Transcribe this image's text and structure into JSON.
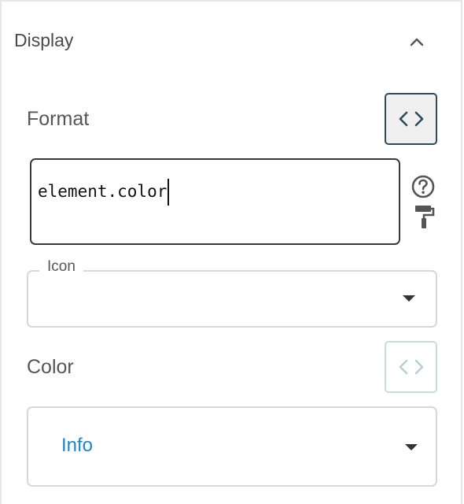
{
  "section": {
    "title": "Display",
    "toggle_icon": "chevron-up-icon"
  },
  "format": {
    "label": "Format",
    "value": "element.color",
    "code_toggle_icon": "code-icon",
    "help_icon": "help-circle-icon",
    "format_icon": "paint-roller-icon"
  },
  "icon_field": {
    "label": "Icon",
    "value": ""
  },
  "color": {
    "label": "Color",
    "value": "Info",
    "code_toggle_icon": "code-icon"
  },
  "colors": {
    "accent": "#1a86c8",
    "active_border": "#2d4b5c",
    "inactive_border": "#c7dbe2"
  }
}
